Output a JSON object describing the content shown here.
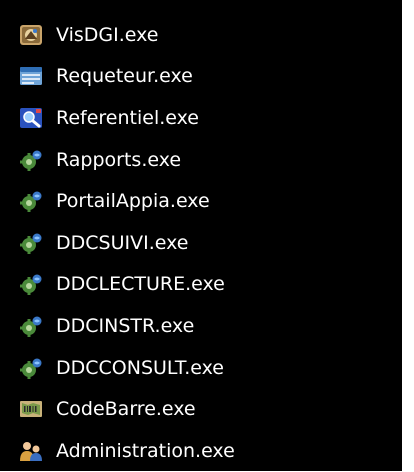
{
  "files": [
    {
      "name": "VisDGI.exe",
      "icon": "visdgi-app-icon"
    },
    {
      "name": "Requeteur.exe",
      "icon": "requeteur-window-icon"
    },
    {
      "name": "Referentiel.exe",
      "icon": "referentiel-search-icon"
    },
    {
      "name": "Rapports.exe",
      "icon": "gear-globe-icon"
    },
    {
      "name": "PortailAppia.exe",
      "icon": "gear-globe-icon"
    },
    {
      "name": "DDCSUIVI.exe",
      "icon": "gear-globe-icon"
    },
    {
      "name": "DDCLECTURE.exe",
      "icon": "gear-globe-icon"
    },
    {
      "name": "DDCINSTR.exe",
      "icon": "gear-globe-icon"
    },
    {
      "name": "DDCCONSULT.exe",
      "icon": "gear-globe-icon"
    },
    {
      "name": "CodeBarre.exe",
      "icon": "barcode-map-icon"
    },
    {
      "name": "Administration.exe",
      "icon": "admin-users-icon"
    }
  ],
  "colors": {
    "background": "#000000",
    "text": "#ffffff",
    "page": "#ffffff"
  }
}
